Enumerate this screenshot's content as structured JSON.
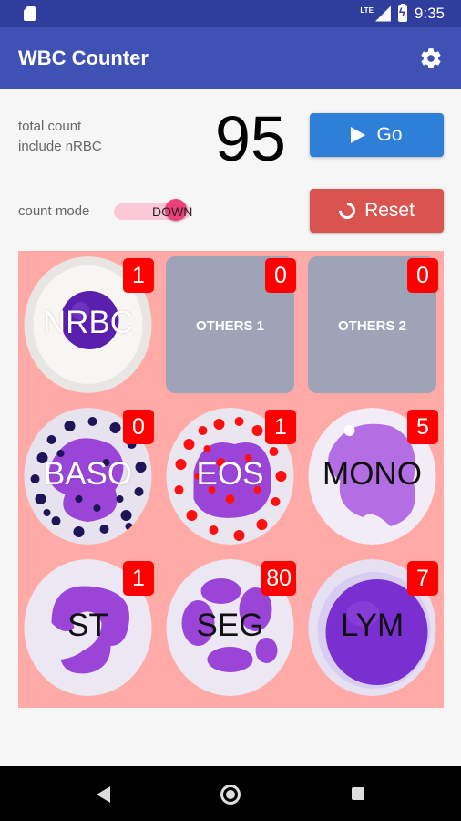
{
  "status_bar": {
    "lte": "LTE",
    "time": "9:35"
  },
  "app_bar": {
    "title": "WBC Counter",
    "settings_icon": "gear-icon"
  },
  "summary": {
    "total_label_line1": "total count",
    "total_label_line2": "include nRBC",
    "total_value": "95",
    "go_label": "Go",
    "go_color": "#2e7fd8"
  },
  "mode": {
    "label": "count mode",
    "toggle_text": "DOWN",
    "reset_label": "Reset",
    "reset_color": "#d9534f"
  },
  "cells": [
    {
      "label": "NRBC",
      "count": "1",
      "style": "round"
    },
    {
      "label": "OTHERS 1",
      "count": "0",
      "style": "rect"
    },
    {
      "label": "OTHERS 2",
      "count": "0",
      "style": "rect"
    },
    {
      "label": "BASO",
      "count": "0",
      "style": "round"
    },
    {
      "label": "EOS",
      "count": "1",
      "style": "round"
    },
    {
      "label": "MONO",
      "count": "5",
      "style": "round"
    },
    {
      "label": "ST",
      "count": "1",
      "style": "round"
    },
    {
      "label": "SEG",
      "count": "80",
      "style": "round"
    },
    {
      "label": "LYM",
      "count": "7",
      "style": "round"
    }
  ],
  "colors": {
    "primary": "#3f51b5",
    "badge": "#ff0000",
    "grid_bg": "#ffaaa6"
  }
}
